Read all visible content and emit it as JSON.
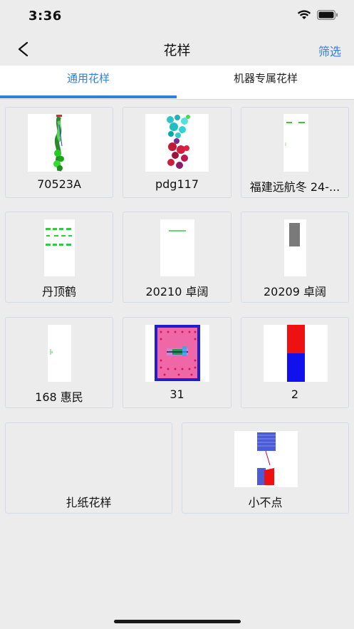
{
  "status": {
    "time": "3:36"
  },
  "nav": {
    "title": "花样",
    "filter_label": "筛选"
  },
  "tabs": [
    {
      "label": "通用花样",
      "active": true
    },
    {
      "label": "机器专属花样",
      "active": false
    }
  ],
  "patterns": [
    {
      "name": "70523A"
    },
    {
      "name": "pdg117"
    },
    {
      "name": "福建远航冬 24-..."
    },
    {
      "name": "丹顶鹤"
    },
    {
      "name": "20210 卓阔"
    },
    {
      "name": "20209 卓阔"
    },
    {
      "name": "168 惠民"
    },
    {
      "name": "31"
    },
    {
      "name": "2"
    },
    {
      "name": "扎纸花样"
    },
    {
      "name": "小不点"
    }
  ],
  "colors": {
    "accent": "#2f7fe0",
    "background": "#ececec"
  }
}
